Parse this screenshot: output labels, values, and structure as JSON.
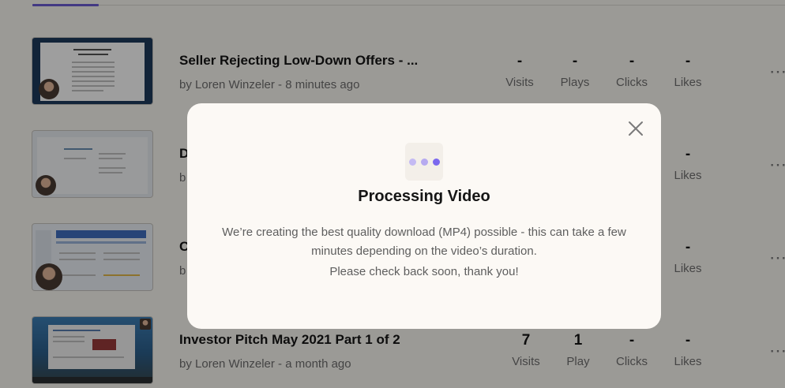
{
  "videos": [
    {
      "title": "Seller Rejecting Low-Down Offers - ...",
      "byline": "by Loren Winzeler - 8 minutes ago",
      "stats": [
        {
          "value": "-",
          "label": "Visits"
        },
        {
          "value": "-",
          "label": "Plays"
        },
        {
          "value": "-",
          "label": "Clicks"
        },
        {
          "value": "-",
          "label": "Likes"
        }
      ]
    },
    {
      "title": "D",
      "byline": "b",
      "stats": [
        {
          "value": "-",
          "label": "Likes"
        }
      ]
    },
    {
      "title": "C",
      "byline": "b",
      "stats": [
        {
          "value": "-",
          "label": "Likes"
        }
      ]
    },
    {
      "title": "Investor Pitch May 2021 Part 1 of 2",
      "byline": "by Loren Winzeler - a month ago",
      "stats": [
        {
          "value": "7",
          "label": "Visits"
        },
        {
          "value": "1",
          "label": "Play"
        },
        {
          "value": "-",
          "label": "Clicks"
        },
        {
          "value": "-",
          "label": "Likes"
        }
      ]
    }
  ],
  "more_icon": "⋯",
  "modal": {
    "title": "Processing Video",
    "body": "We’re creating the best quality download (MP4) possible - this can take a few minutes depending on the video’s duration.",
    "note": "Please check back soon, thank you!",
    "close_icon": "close-icon",
    "loader_icon": "three-dots-loader-icon"
  },
  "colors": {
    "accent": "#6d5dd3",
    "dot_light": "#b9aef2",
    "dot_dark": "#7b68ee",
    "backdrop": "rgba(0,0,0,0.38)"
  }
}
